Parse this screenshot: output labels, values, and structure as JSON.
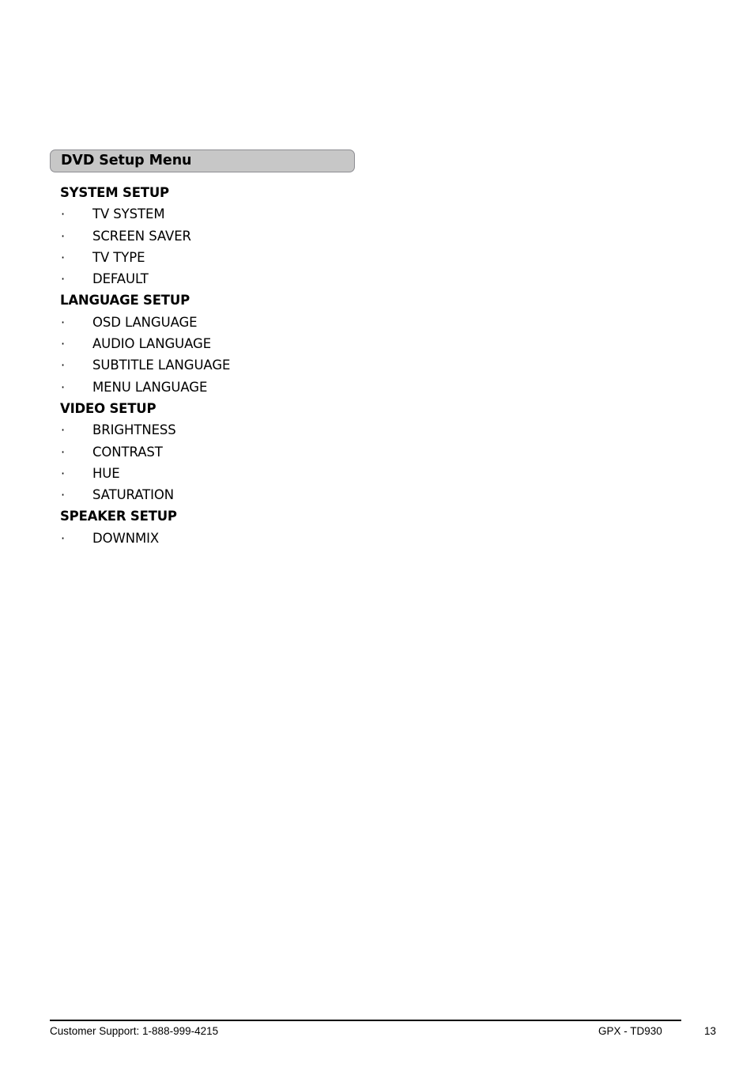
{
  "document": {
    "page_number": "13",
    "section_title": "DVD Setup Menu"
  },
  "outline": {
    "groups": [
      {
        "heading": "SYSTEM SETUP",
        "items": [
          "TV SYSTEM",
          "SCREEN SAVER",
          "TV TYPE",
          "DEFAULT"
        ]
      },
      {
        "heading": "LANGUAGE SETUP",
        "items": [
          "OSD LANGUAGE",
          "AUDIO LANGUAGE",
          "SUBTITLE LANGUAGE",
          "MENU LANGUAGE"
        ]
      },
      {
        "heading": "VIDEO SETUP",
        "items": [
          "BRIGHTNESS",
          "CONTRAST",
          "HUE",
          "SATURATION"
        ]
      },
      {
        "heading": "SPEAKER SETUP",
        "items": [
          "DOWNMIX"
        ]
      }
    ],
    "bullet_glyph": "·"
  },
  "footer": {
    "customer_support": "Customer Support: 1-888-999-4215",
    "model": "GPX - TD930",
    "page_number": "13"
  },
  "colors": {
    "page_background": "#ffffff",
    "section_bar_fill": "#c7c7c7",
    "section_bar_border": "#8d8d92",
    "text": "#000000"
  }
}
